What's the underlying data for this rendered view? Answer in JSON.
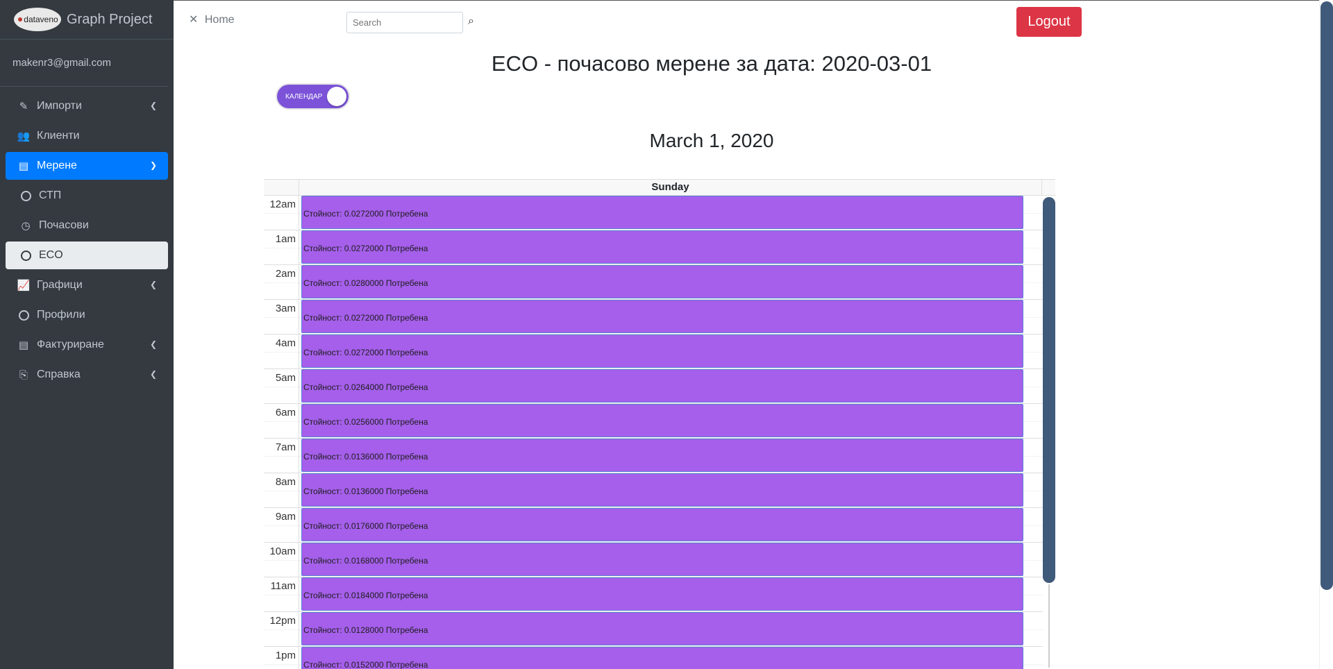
{
  "brand": {
    "logo_text": "dataveno",
    "title": "Graph Project"
  },
  "user": {
    "email": "makenr3@gmail.com"
  },
  "nav": [
    {
      "label": "Импорти",
      "icon": "edit-icon",
      "arrow": "‹"
    },
    {
      "label": "Клиенти",
      "icon": "users-icon",
      "arrow": ""
    },
    {
      "label": "Мерене",
      "icon": "file-icon",
      "arrow": "⌄"
    },
    {
      "label": "СТП",
      "icon": "circle-icon",
      "arrow": ""
    },
    {
      "label": "Почасови",
      "icon": "clock-icon",
      "arrow": ""
    },
    {
      "label": "ECO",
      "icon": "circle-icon",
      "arrow": ""
    },
    {
      "label": "Графици",
      "icon": "chart-icon",
      "arrow": "‹"
    },
    {
      "label": "Профили",
      "icon": "circle-icon",
      "arrow": ""
    },
    {
      "label": "Фактуриране",
      "icon": "invoice-icon",
      "arrow": "‹"
    },
    {
      "label": "Справка",
      "icon": "report-icon",
      "arrow": "‹"
    }
  ],
  "topbar": {
    "home_label": "Home",
    "close_glyph": "✕",
    "search_placeholder": "Search",
    "logout_label": "Logout"
  },
  "page": {
    "title": "ECO - почасово мерене за дата: 2020-03-01",
    "toggle_label": "КАЛЕНДАР",
    "calendar_date": "March 1, 2020"
  },
  "calendar": {
    "day_header": "Sunday",
    "rows": [
      {
        "time": "12am",
        "event": "Стойност: 0.0272000 Потребена"
      },
      {
        "time": "1am",
        "event": "Стойност: 0.0272000 Потребена"
      },
      {
        "time": "2am",
        "event": "Стойност: 0.0280000 Потребена"
      },
      {
        "time": "3am",
        "event": "Стойност: 0.0272000 Потребена"
      },
      {
        "time": "4am",
        "event": "Стойност: 0.0272000 Потребена"
      },
      {
        "time": "5am",
        "event": "Стойност: 0.0264000 Потребена"
      },
      {
        "time": "6am",
        "event": "Стойност: 0.0256000 Потребена"
      },
      {
        "time": "7am",
        "event": "Стойност: 0.0136000 Потребена"
      },
      {
        "time": "8am",
        "event": "Стойност: 0.0136000 Потребена"
      },
      {
        "time": "9am",
        "event": "Стойност: 0.0176000 Потребена"
      },
      {
        "time": "10am",
        "event": "Стойност: 0.0168000 Потребена"
      },
      {
        "time": "11am",
        "event": "Стойност: 0.0184000 Потребена"
      },
      {
        "time": "12pm",
        "event": "Стойност: 0.0128000 Потребена"
      },
      {
        "time": "1pm",
        "event": "Стойност: 0.0152000 Потребена"
      }
    ]
  },
  "colors": {
    "sidebar": "#343a40",
    "active": "#007bff",
    "event": "#a55fea",
    "logout": "#dc3545",
    "toggle": "#7b52d8"
  }
}
